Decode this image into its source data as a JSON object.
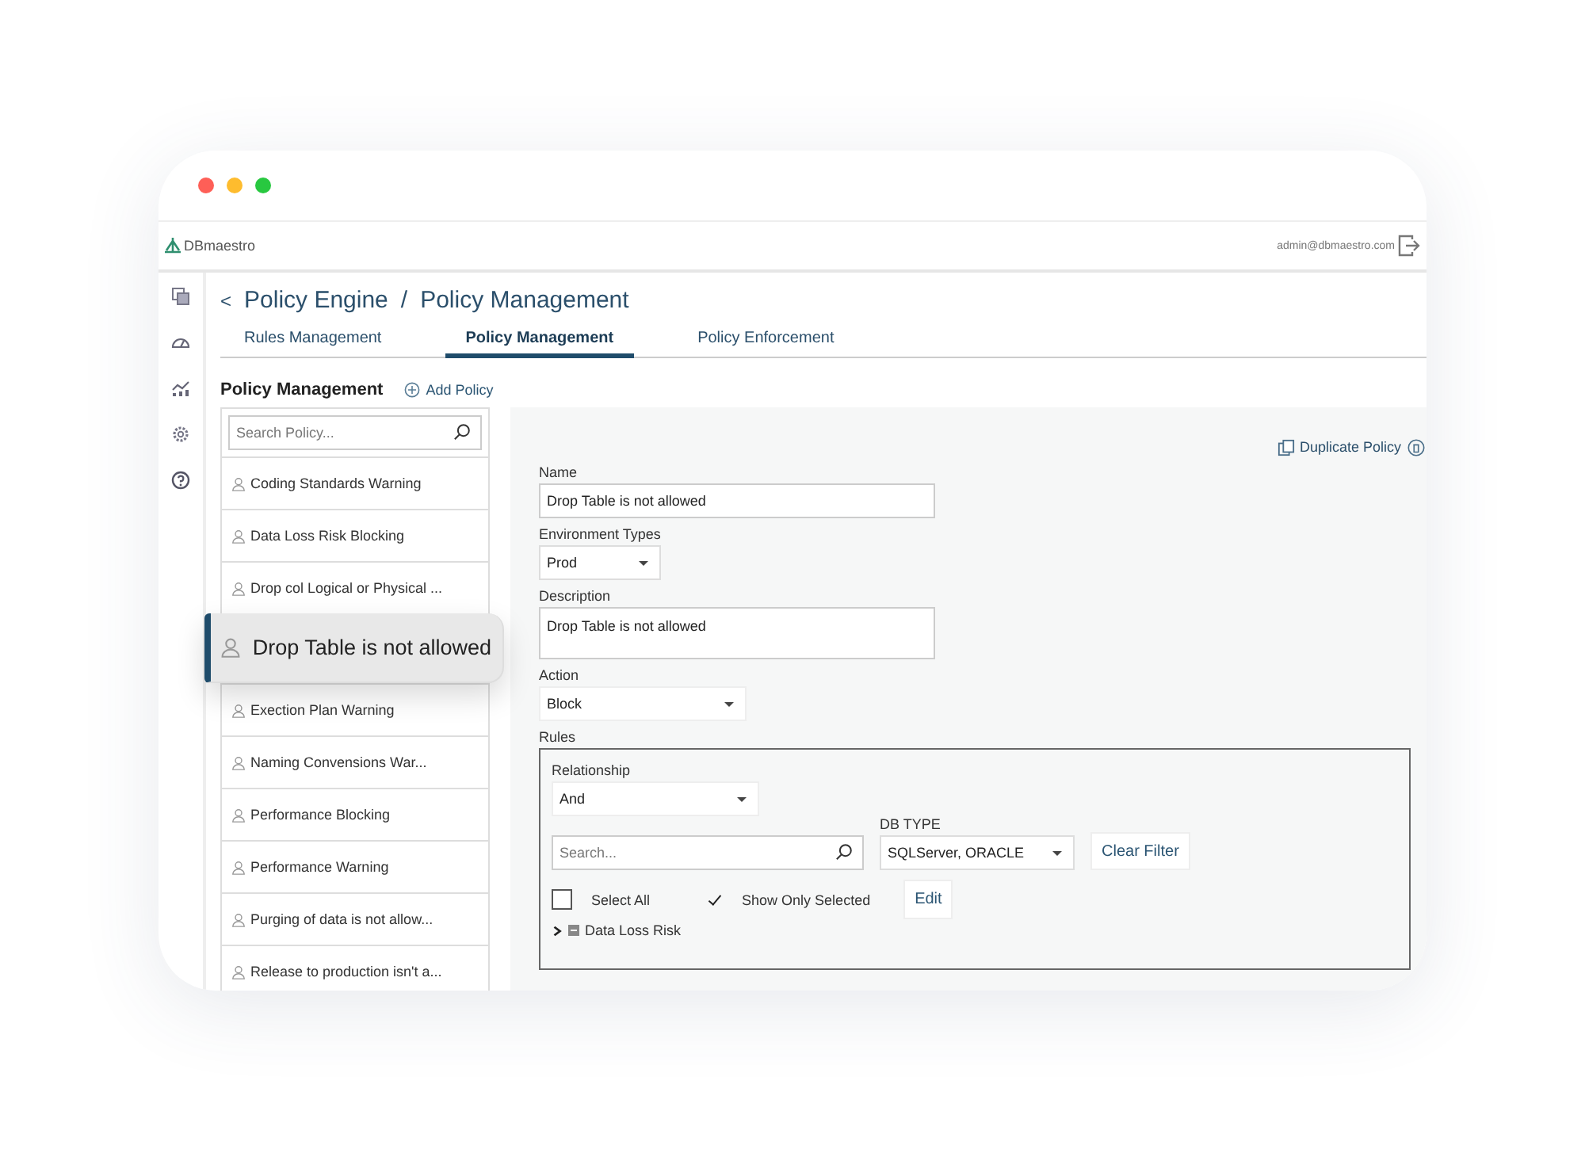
{
  "header": {
    "logo": "DBmaestro",
    "user": "admin@dbmaestro.com"
  },
  "breadcrumb": {
    "back": "<",
    "parts": [
      "Policy Engine",
      "Policy Management"
    ],
    "separator": "/"
  },
  "tabs": [
    {
      "label": "Rules Management",
      "selected": false
    },
    {
      "label": "Policy Management",
      "selected": true
    },
    {
      "label": "Policy Enforcement",
      "selected": false
    }
  ],
  "policy_list": {
    "title": "Policy Management",
    "add_label": "Add Policy",
    "search": {
      "placeholder": "Search Policy..."
    },
    "items": [
      {
        "label": "Coding Standards Warning",
        "selected": false
      },
      {
        "label": "Data Loss Risk Blocking",
        "selected": false
      },
      {
        "label": "Drop col Logical or Physical ...",
        "selected": false
      },
      {
        "label": "Drop Table is not allowed",
        "selected": true
      },
      {
        "label": "Exection Plan Warning",
        "selected": false
      },
      {
        "label": "Naming Convensions War...",
        "selected": false
      },
      {
        "label": "Performance Blocking",
        "selected": false
      },
      {
        "label": "Performance Warning",
        "selected": false
      },
      {
        "label": "Purging of data is not allow...",
        "selected": false
      },
      {
        "label": "Release to production isn't a...",
        "selected": false
      }
    ]
  },
  "form": {
    "duplicate_label": "Duplicate Policy",
    "name": {
      "label": "Name",
      "value": "Drop Table is not allowed"
    },
    "environment": {
      "label": "Environment Types",
      "value": "Prod"
    },
    "description": {
      "label": "Description",
      "value": "Drop Table is not allowed"
    },
    "action": {
      "label": "Action",
      "value": "Block"
    },
    "rules": {
      "label": "Rules",
      "relationship": {
        "label": "Relationship",
        "value": "And"
      },
      "search": {
        "placeholder": "Search..."
      },
      "db_type": {
        "label": "DB TYPE",
        "value": "SQLServer, ORACLE"
      },
      "clear_filter": "Clear Filter",
      "select_all": {
        "label": "Select All",
        "checked": false
      },
      "show_only_selected": {
        "label": "Show Only Selected",
        "checked": true
      },
      "edit": "Edit",
      "tree": [
        {
          "label": "Data Loss Risk",
          "expanded": false
        }
      ]
    }
  }
}
